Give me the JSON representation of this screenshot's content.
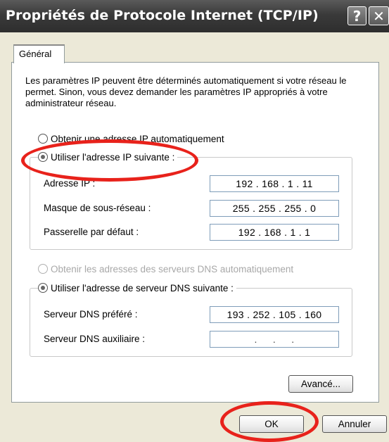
{
  "window": {
    "title": "Propriétés de Protocole Internet (TCP/IP)",
    "help_label": "?",
    "close_label": "✕"
  },
  "tabs": [
    {
      "label": "Général",
      "active": true
    }
  ],
  "description": "Les paramètres IP peuvent être déterminés automatiquement si votre réseau le permet. Sinon, vous devez demander les paramètres IP appropriés à votre administrateur réseau.",
  "ip": {
    "auto_label": "Obtenir une adresse IP automatiquement",
    "manual_label": "Utiliser l'adresse IP suivante :",
    "selected": "manual",
    "fields": [
      {
        "label": "Adresse IP :",
        "value": "192 . 168 . 1 . 11"
      },
      {
        "label": "Masque de sous-réseau :",
        "value": "255 . 255 . 255 . 0"
      },
      {
        "label": "Passerelle par défaut :",
        "value": "192 . 168 . 1 . 1"
      }
    ]
  },
  "dns": {
    "auto_label": "Obtenir les adresses des serveurs DNS automatiquement",
    "auto_disabled": true,
    "manual_label": "Utiliser l'adresse de serveur DNS suivante :",
    "selected": "manual",
    "fields": [
      {
        "label": "Serveur DNS préféré :",
        "value": "193 . 252 . 105 . 160"
      },
      {
        "label": "Serveur DNS auxiliaire :",
        "value": ". . ."
      }
    ]
  },
  "buttons": {
    "advanced": "Avancé...",
    "ok": "OK",
    "cancel": "Annuler"
  },
  "annotations": {
    "color": "#e8221b",
    "highlighted": [
      "manual-ip-option",
      "ok-button"
    ]
  }
}
